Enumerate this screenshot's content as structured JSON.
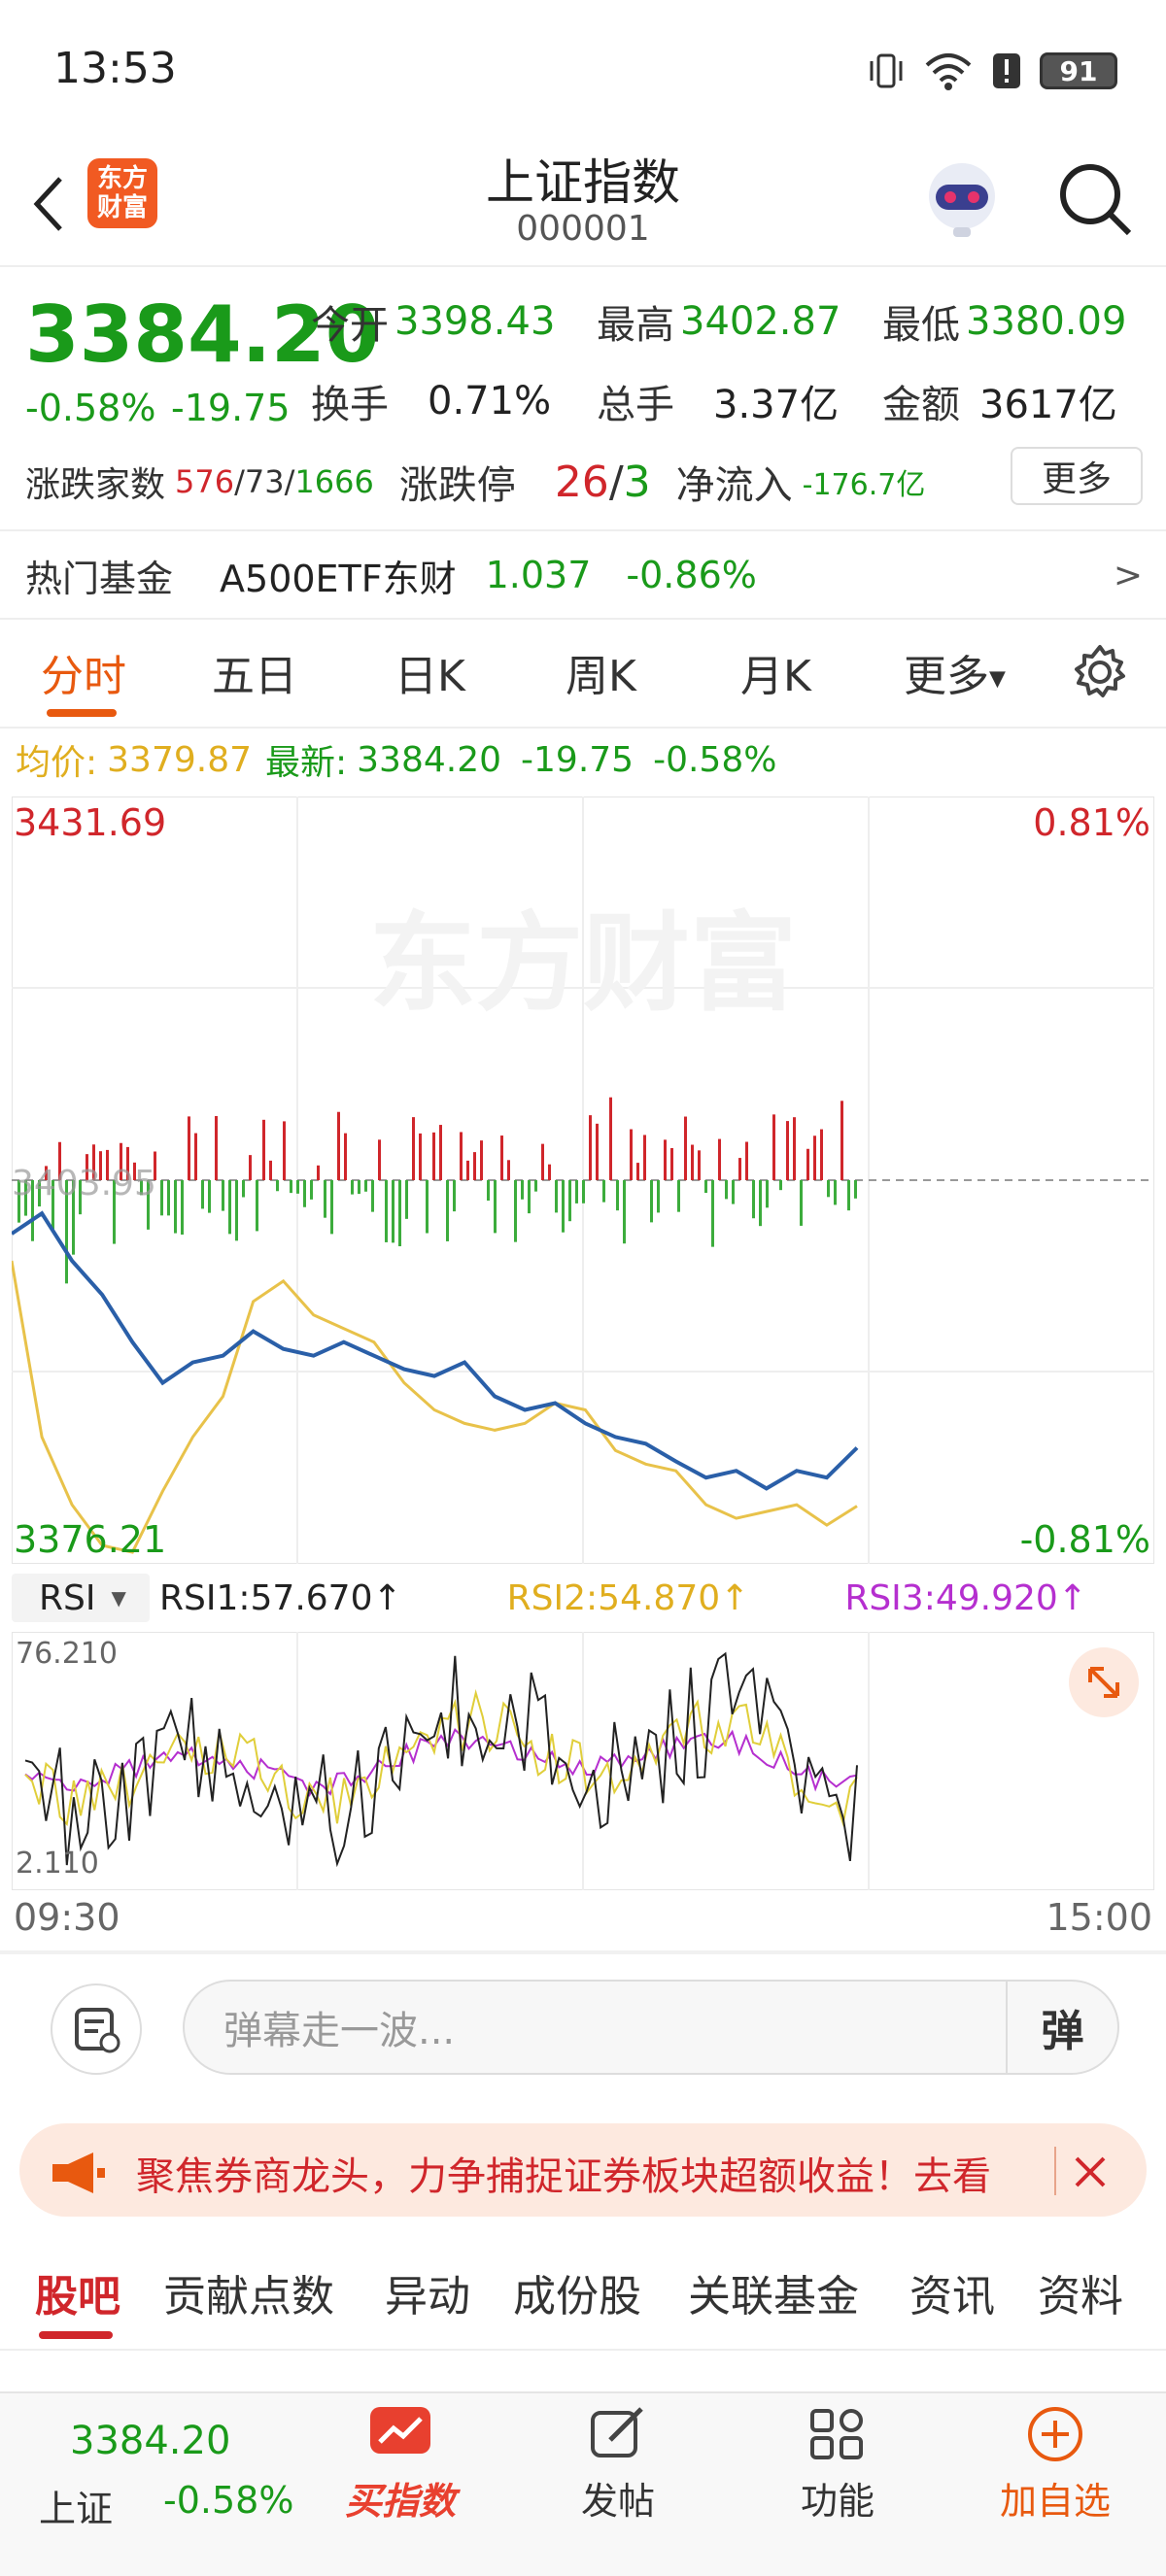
{
  "status_bar": {
    "time": "13:53",
    "battery": "91"
  },
  "nav": {
    "title": "上证指数",
    "code": "000001",
    "brand_line1": "东方",
    "brand_line2": "财富"
  },
  "quote": {
    "price": "3384.20",
    "change_pct": "-0.58%",
    "change_amt": "-19.75",
    "open_label": "今开",
    "open": "3398.43",
    "high_label": "最高",
    "high": "3402.87",
    "low_label": "最低",
    "low": "3380.09",
    "turnover_label": "换手",
    "turnover": "0.71%",
    "volume_label": "总手",
    "volume": "3.37亿",
    "amount_label": "金额",
    "amount": "3617亿",
    "breadth_label": "涨跌家数",
    "up_count": "576",
    "flat_count": "73",
    "down_count": "1666",
    "limit_label": "涨跌停",
    "limit_up": "26",
    "limit_down": "3",
    "netflow_label": "净流入",
    "netflow": "-176.7亿",
    "more": "更多"
  },
  "hot_fund": {
    "label": "热门基金",
    "name": "A500ETF东财",
    "price": "1.037",
    "pct": "-0.86%",
    "arrow": ">"
  },
  "chart_tabs": [
    "分时",
    "五日",
    "日K",
    "周K",
    "月K",
    "更多"
  ],
  "avg_line": {
    "avg_label": "均价:",
    "avg": "3379.87",
    "last_label": "最新:",
    "last": "3384.20",
    "chg": "-19.75",
    "pct": "-0.58%"
  },
  "intraday": {
    "top_price": "3431.69",
    "bottom_price": "3376.21",
    "top_pct": "0.81%",
    "bottom_pct": "-0.81%",
    "mid_price": "3403.95",
    "watermark": "东方财富"
  },
  "rsi": {
    "selector": "RSI",
    "rsi1": "RSI1:57.670↑",
    "rsi2": "RSI2:54.870↑",
    "rsi3": "RSI3:49.920↑",
    "max": "76.210",
    "min": "2.110"
  },
  "time_axis": {
    "start": "09:30",
    "end": "15:00"
  },
  "comment": {
    "placeholder": "弹幕走一波...",
    "danmu": "弹"
  },
  "promo": {
    "text": "聚焦券商龙头，力争捕捉证券板块超额收益！去看"
  },
  "section_tabs": [
    "股吧",
    "贡献点数",
    "异动",
    "成份股",
    "关联基金",
    "资讯",
    "资料"
  ],
  "bottom_bar": {
    "price": "3384.20",
    "name": "上证",
    "pct": "-0.58%",
    "buy_index": "买指数",
    "post": "发帖",
    "features": "功能",
    "add_watch": "加自选"
  },
  "colors": {
    "up": "#d0262b",
    "down": "#1a9a1a",
    "avg": "#e0ae1f",
    "price_line": "#2a5fa8",
    "accent": "#e8590f",
    "rsi3": "#b52fcf"
  },
  "chart_data": {
    "type": "line",
    "x": [
      "09:30",
      "15:00"
    ],
    "ylim": [
      3376.21,
      3431.69
    ],
    "series": [
      {
        "values": [
          3400.0,
          3401.5,
          3398.0,
          3395.5,
          3392.0,
          3389.0,
          3390.5,
          3391.0,
          3392.8,
          3391.5,
          3391.0,
          3392.0,
          3391.0,
          3390.0,
          3389.5,
          3390.5,
          3388.0,
          3387.0,
          3387.5,
          3386.0,
          3385.0,
          3384.5,
          3383.2,
          3382.0,
          3382.5,
          3381.2,
          3382.5,
          3382.0,
          3384.2
        ]
      },
      {
        "values": [
          3398.0,
          3385.0,
          3380.0,
          3377.0,
          3376.5,
          3381.0,
          3385.0,
          3388.0,
          3395.0,
          3396.5,
          3394.0,
          3393.0,
          3392.0,
          3389.0,
          3387.0,
          3386.0,
          3385.5,
          3386.0,
          3387.5,
          3387.0,
          3384.0,
          3383.0,
          3382.5,
          3380.0,
          3379.0,
          3379.5,
          3380.0,
          3378.5,
          3379.9
        ]
      }
    ]
  }
}
